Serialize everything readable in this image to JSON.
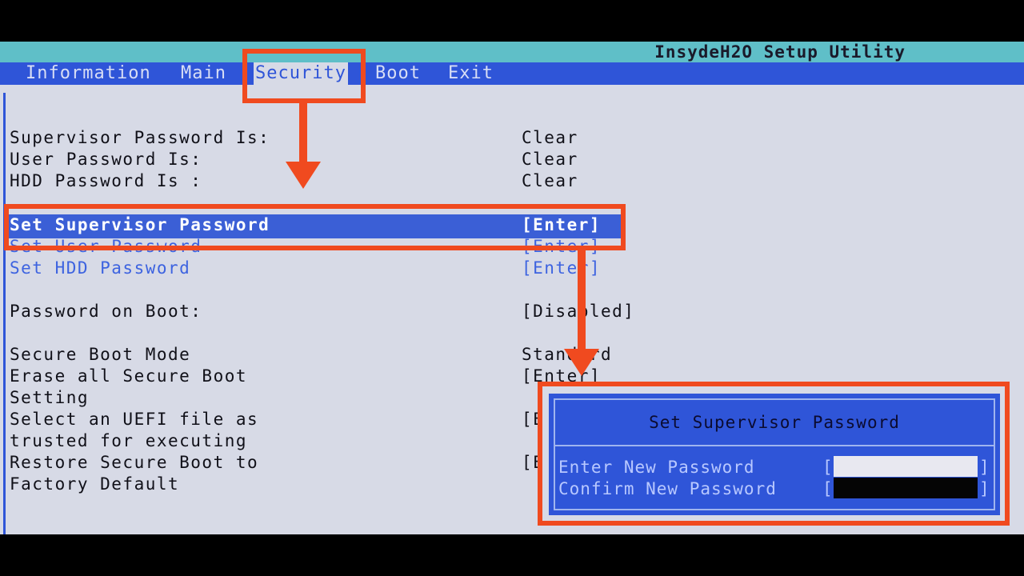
{
  "app": {
    "title": "InsydeH2O Setup Utility"
  },
  "menu": [
    {
      "label": "Information"
    },
    {
      "label": "Main"
    },
    {
      "label": "Security"
    },
    {
      "label": "Boot"
    },
    {
      "label": "Exit"
    }
  ],
  "status": [
    {
      "label": "Supervisor Password Is:",
      "value": "Clear"
    },
    {
      "label": "User Password Is:",
      "value": "Clear"
    },
    {
      "label": "HDD Password Is :",
      "value": "Clear"
    }
  ],
  "password_options": [
    {
      "label": "Set Supervisor Password",
      "value": "[Enter]"
    },
    {
      "label": "Set User Password",
      "value": "[Enter]"
    },
    {
      "label": "Set HDD Password",
      "value": "[Enter]"
    }
  ],
  "boot_password": {
    "label": "Password on Boot:",
    "value": "[Disabled]"
  },
  "secure_boot": {
    "mode_label": "Secure Boot Mode",
    "mode_value": "Standard",
    "erase_label_1": "Erase all Secure Boot",
    "erase_label_2": "Setting",
    "erase_value": "[Enter]",
    "select_label_1": "Select an UEFI file as",
    "select_label_2": "trusted for executing",
    "select_value": "[E",
    "restore_label_1": "Restore Secure Boot to",
    "restore_label_2": "Factory Default",
    "restore_value": "[E"
  },
  "popup": {
    "title": "Set Supervisor Password",
    "enter_label": "Enter New Password",
    "confirm_label": "Confirm New Password",
    "bracket_open": "[",
    "bracket_close": "]"
  },
  "colors": {
    "annotation": "#f04a1f",
    "menu_bar": "#2f55d8",
    "title_bar": "#5fbfc8",
    "background": "#d7dae6"
  }
}
